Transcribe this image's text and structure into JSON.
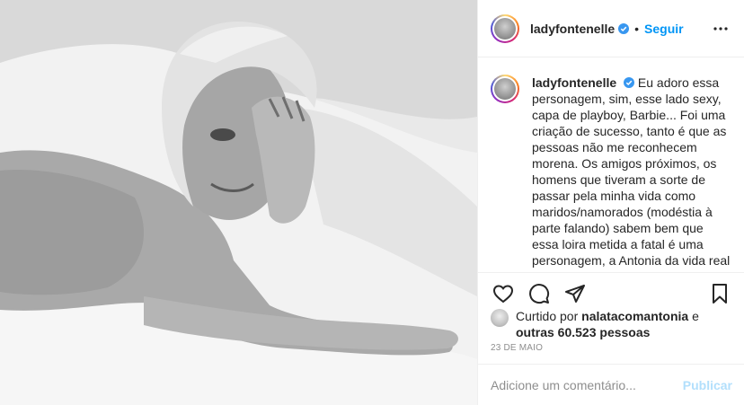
{
  "post": {
    "username": "ladyfontenelle",
    "follow_label": "Seguir",
    "separator": "•",
    "caption": "Eu adoro essa personagem, sim, esse lado sexy, capa de playboy, Barbie... Foi uma criação de sucesso, tanto é que as pessoas não me reconhecem morena. Os amigos próximos, os homens que tiveram a sorte de passar pela minha vida como maridos/namorados (modéstia à parte falando) sabem bem que essa loira metida a fatal é uma personagem, a Antonia da vida real é bem diferente, seria, comedida... Mas posso garantir que também tem seus encantos. Espero não ter",
    "liked_prefix": "Curtido por",
    "liked_by": "nalatacomantonia",
    "liked_joiner": "e",
    "others": "outras 60.523 pessoas",
    "date": "23 DE MAIO",
    "comment_placeholder": "Adicione um comentário...",
    "publish_label": "Publicar"
  },
  "icons": {
    "verified": "verified-badge-icon",
    "more": "more-options-icon",
    "like": "heart-icon",
    "comment": "comment-icon",
    "share": "share-icon",
    "save": "bookmark-icon"
  },
  "colors": {
    "accent": "#0095f6",
    "muted": "#8e8e8e",
    "publish_disabled": "#b2dffc",
    "border": "#efefef"
  }
}
